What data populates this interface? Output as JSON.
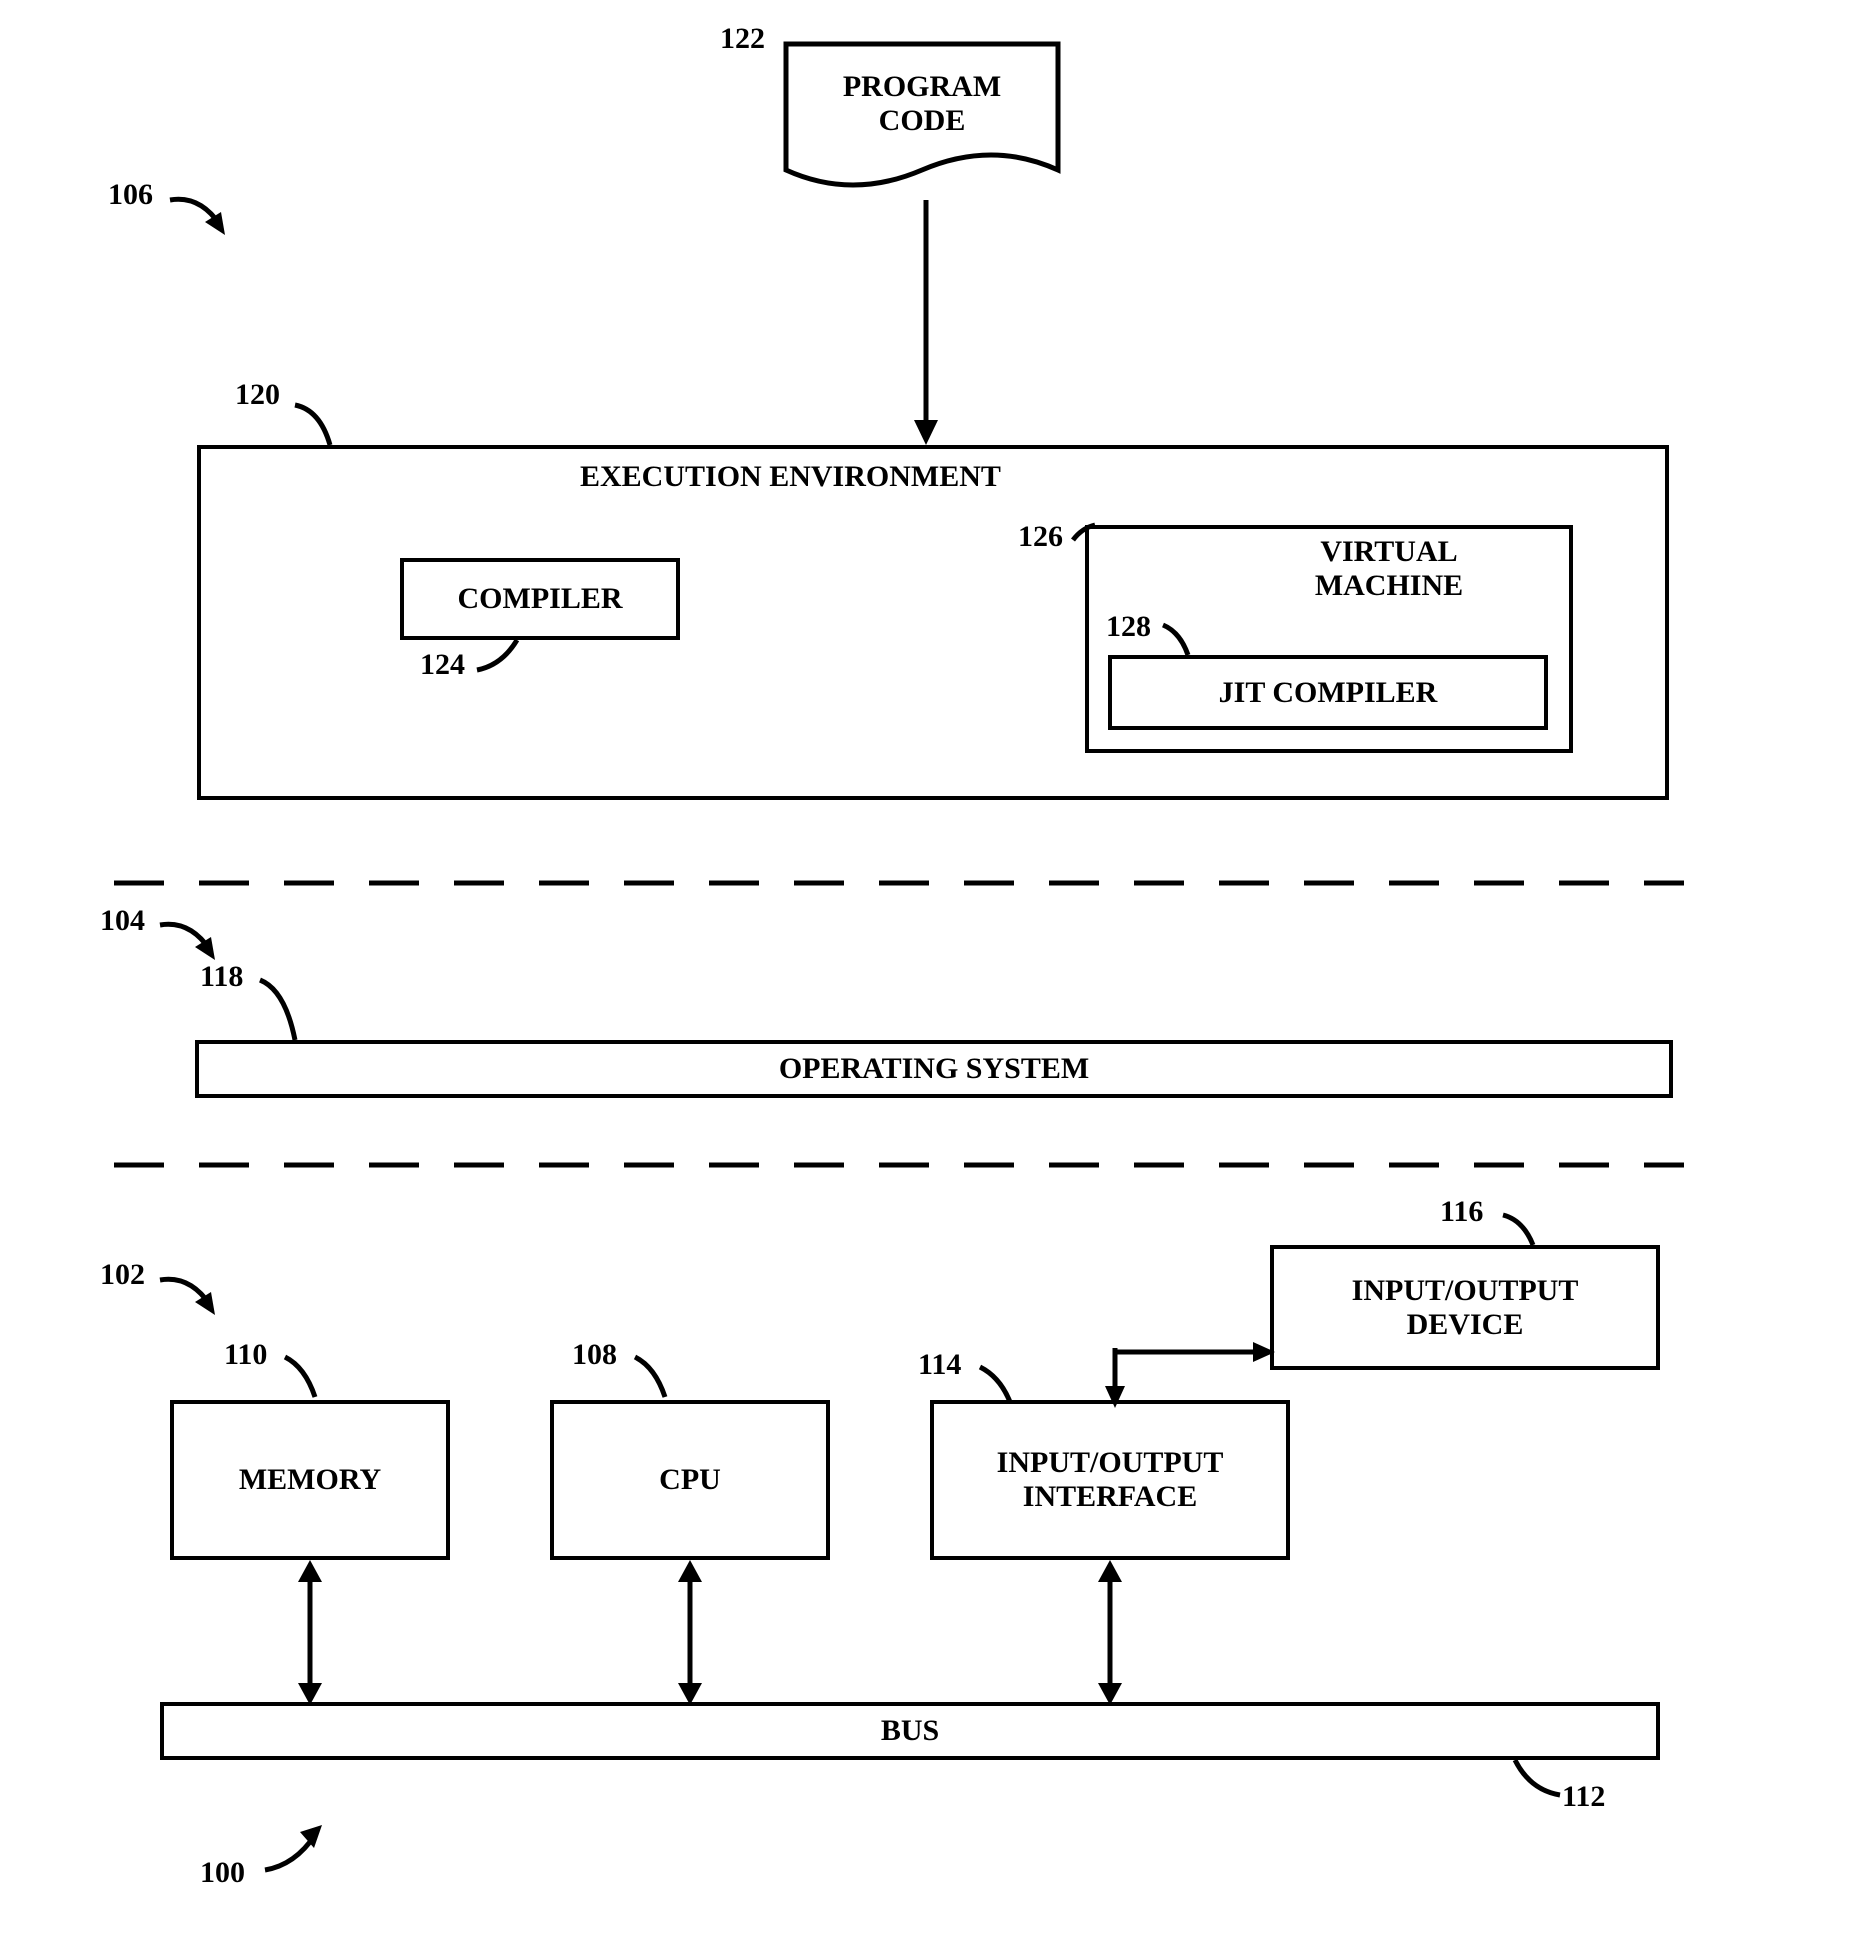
{
  "refs": {
    "r100": "100",
    "r102": "102",
    "r104": "104",
    "r106": "106",
    "r108": "108",
    "r110": "110",
    "r112": "112",
    "r114": "114",
    "r116": "116",
    "r118": "118",
    "r120": "120",
    "r122": "122",
    "r124": "124",
    "r126": "126",
    "r128": "128"
  },
  "blocks": {
    "program_code": "PROGRAM\nCODE",
    "exec_env": "EXECUTION ENVIRONMENT",
    "compiler": "COMPILER",
    "virtual_machine": "VIRTUAL\nMACHINE",
    "jit_compiler": "JIT COMPILER",
    "os": "OPERATING SYSTEM",
    "memory": "MEMORY",
    "cpu": "CPU",
    "io_iface": "INPUT/OUTPUT\nINTERFACE",
    "io_device": "INPUT/OUTPUT\nDEVICE",
    "bus": "BUS"
  }
}
